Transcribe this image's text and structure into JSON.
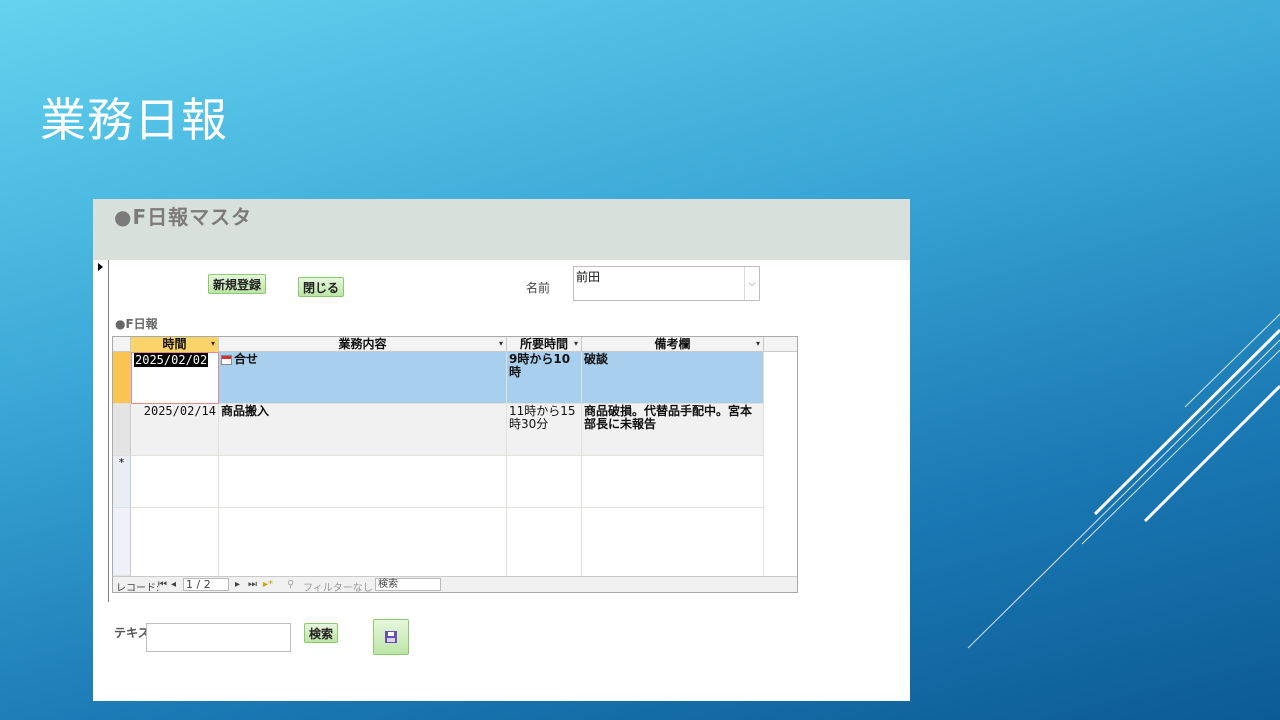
{
  "slide": {
    "title": "業務日報"
  },
  "form": {
    "caption": "●F日報マスタ",
    "buttons": {
      "new_label": "新規登録",
      "close_label": "閉じる",
      "search_label": "検索"
    },
    "name_label": "名前",
    "name_value": "前田",
    "subform_label": "●F日報",
    "text_label": "テキス"
  },
  "grid": {
    "columns": [
      "時間",
      "業務内容",
      "所要時間",
      "備考欄"
    ],
    "rows": [
      {
        "date": "2025/02/02",
        "task": "合せ",
        "duration": "9時から10時",
        "note": "破談"
      },
      {
        "date": "2025/02/14",
        "task": "商品搬入",
        "duration": "11時から15時30分",
        "note": "商品破損。代替品手配中。宮本部長に未報告"
      }
    ],
    "new_row_marker": "*"
  },
  "navbar": {
    "record_label": "レコード:",
    "position": "1 / 2",
    "filter_label": "フィルターなし",
    "search_placeholder": "検索"
  },
  "icons": {
    "nav_first": "⏮",
    "nav_prev": "◂",
    "nav_next": "▸",
    "nav_last": "⏭",
    "nav_new": "▸*",
    "dropdown": "⌵"
  }
}
